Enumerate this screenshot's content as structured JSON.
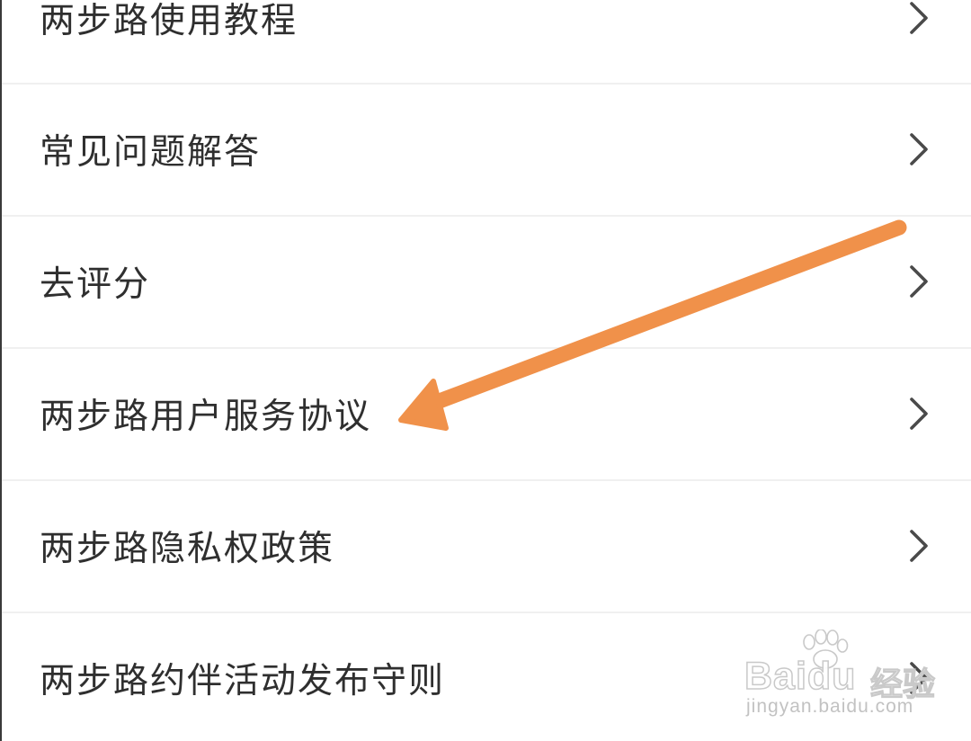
{
  "menu": {
    "items": [
      {
        "label": "两步路使用教程",
        "icon": "chevron-right-icon"
      },
      {
        "label": "常见问题解答",
        "icon": "chevron-right-icon"
      },
      {
        "label": "去评分",
        "icon": "chevron-right-icon"
      },
      {
        "label": "两步路用户服务协议",
        "icon": "chevron-right-icon"
      },
      {
        "label": "两步路隐私权政策",
        "icon": "chevron-right-icon"
      },
      {
        "label": "两步路约伴活动发布守则",
        "icon": "chevron-right-icon"
      }
    ]
  },
  "annotation": {
    "icon": "arrow-icon",
    "color": "#f0914a"
  },
  "watermark": {
    "brand": "Baidu",
    "cn": "经验",
    "url": "jingyan.baidu.com",
    "icon": "paw-icon"
  },
  "colors": {
    "text": "#2f2f2f",
    "chevron": "#4a4a4a",
    "divider": "#f0f0f0",
    "accent": "#f0914a"
  }
}
